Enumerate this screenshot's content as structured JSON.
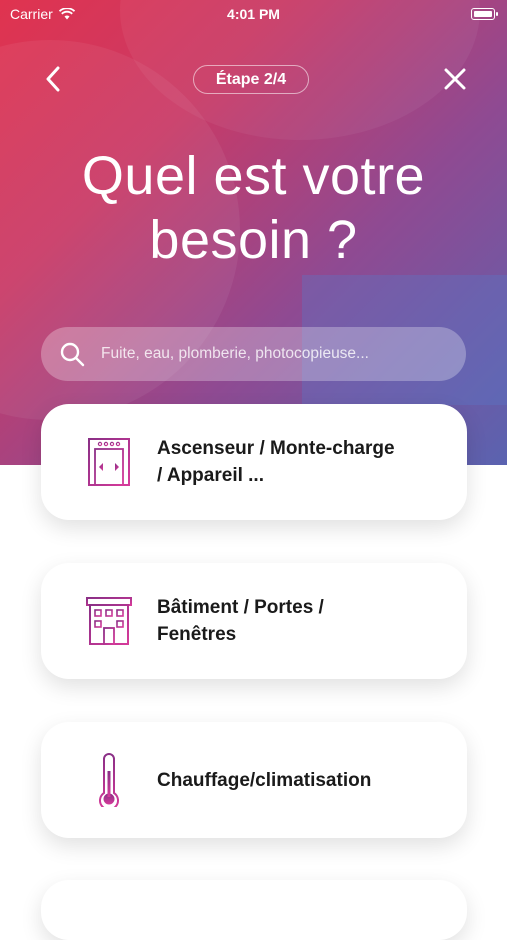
{
  "status_bar": {
    "carrier": "Carrier",
    "time": "4:01 PM"
  },
  "nav": {
    "step": "Étape 2/4"
  },
  "title": "Quel est votre besoin ?",
  "search": {
    "placeholder": "Fuite, eau, plomberie, photocopieuse..."
  },
  "categories": [
    {
      "label": "Ascenseur / Monte-charge / Appareil ...",
      "icon": "elevator-icon"
    },
    {
      "label": "Bâtiment / Portes / Fenêtres",
      "icon": "building-icon"
    },
    {
      "label": "Chauffage/climatisation",
      "icon": "thermometer-icon"
    }
  ],
  "colors": {
    "gradient_start": "#e0334f",
    "gradient_end": "#5a63b0",
    "icon_purple": "#8a2f86",
    "icon_pink": "#d63a9a"
  }
}
